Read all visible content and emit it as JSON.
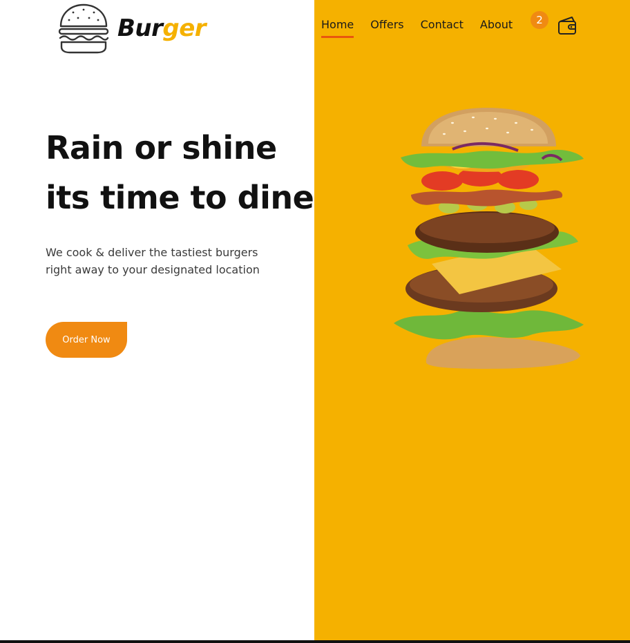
{
  "brand": {
    "part_a": "Bur",
    "part_b": "ger"
  },
  "nav": {
    "items": [
      {
        "label": "Home",
        "active": true
      },
      {
        "label": "Offers",
        "active": false
      },
      {
        "label": "Contact",
        "active": false
      },
      {
        "label": "About",
        "active": false
      }
    ],
    "cart_count": "2"
  },
  "hero": {
    "title_line1": "Rain or shine",
    "title_line2": "its time to dine",
    "subtitle_line1": "We cook & deliver the tastiest burgers",
    "subtitle_line2": "right away to your designated location",
    "cta_label": "Order Now"
  },
  "icons": {
    "logo": "burger-outline-icon",
    "cart": "wallet-icon"
  },
  "colors": {
    "accent_yellow": "#F5B100",
    "accent_orange": "#F08A12",
    "active_underline": "#E8560F",
    "text_dark": "#111111"
  }
}
